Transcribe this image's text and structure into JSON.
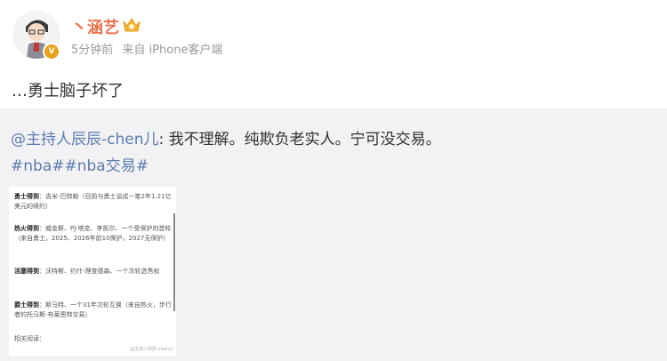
{
  "post": {
    "username": "丶涵艺",
    "time": "5分钟前",
    "source": "来自 iPhone客户端",
    "text": "…勇士脑子坏了",
    "badge": "V"
  },
  "repost": {
    "mention": "@主持人辰辰-chen儿",
    "text": ": 我不理解。纯欺负老实人。宁可没交易。",
    "topic1": "#nba#",
    "topic2": "#nba交易#"
  },
  "image": {
    "block1_head": "勇士得到",
    "block1_text": "：吉米-巴特勒（目前与勇士谈成一笔2年1.21亿美元的续约）",
    "block2_head": "热火得到",
    "block2_text": "：威金斯、PJ-塔克、李凯尔、一个受保护的首轮（来自勇士，2025、2026年前10保护，2027无保护）",
    "block3_head": "活塞得到",
    "block3_text": "：沃特斯、约什-理查德森、一个次轮选秀权",
    "block4_head": "爵士得到",
    "block4_text": "：斯马特、一个31年次轮互换（来自热火，步行者的托马斯-布莱恩特交易）",
    "footer": "相关阅读：",
    "watermark": "@主持人辰辰-chen儿"
  },
  "colors": {
    "username": "#eb7350",
    "link": "#5d7cad",
    "repost_bg": "#f2f2f5",
    "meta": "#999999"
  }
}
